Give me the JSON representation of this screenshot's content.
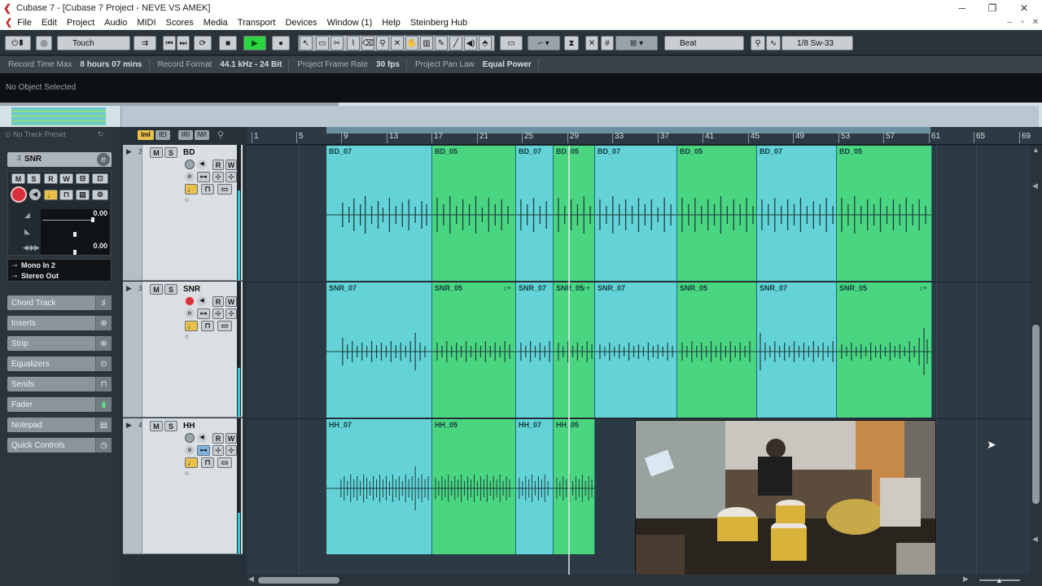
{
  "window": {
    "title": "Cubase 7 - [Cubase 7 Project - NEVE VS AMEK]",
    "controls": {
      "minimize": "─",
      "maximize": "❐",
      "close": "✕"
    }
  },
  "menu": {
    "items": [
      "File",
      "Edit",
      "Project",
      "Audio",
      "MIDI",
      "Scores",
      "Media",
      "Transport",
      "Devices",
      "Window (1)",
      "Help",
      "Steinberg Hub"
    ],
    "doc_controls": {
      "minimize": "–",
      "restore": "▫",
      "close": "✕"
    }
  },
  "toolbar": {
    "automation_mode": "Touch",
    "snap_type": "Beat",
    "quantize": "1/8 Sw-33",
    "play_color": "#2bd640"
  },
  "info_line": [
    {
      "label": "Record Time Max",
      "value": "8 hours 07 mins"
    },
    {
      "label": "Record Format",
      "value": "44.1 kHz - 24 Bit"
    },
    {
      "label": "Project Frame Rate",
      "value": "30 fps"
    },
    {
      "label": "Project Pan Law",
      "value": "Equal Power"
    }
  ],
  "object_line": "No Object Selected",
  "inspector": {
    "preset": "No Track Preset",
    "track_name": "SNR",
    "track_number": "3",
    "volume": "0.00",
    "pan": "0.00",
    "input": "Mono In 2",
    "output": "Stereo Out",
    "sections": [
      "Chord Track",
      "Inserts",
      "Strip",
      "Equalizers",
      "Sends",
      "Fader",
      "Notepad",
      "Quick Controls"
    ]
  },
  "tracks": [
    {
      "number": "2",
      "name": "BD",
      "parts": [
        {
          "name": "BD_07",
          "color": "cyan"
        },
        {
          "name": "BD_05",
          "color": "green"
        },
        {
          "name": "BD_07",
          "color": "cyan"
        },
        {
          "name": "BD_05",
          "color": "green"
        },
        {
          "name": "BD_07",
          "color": "cyan"
        },
        {
          "name": "BD_05",
          "color": "green"
        },
        {
          "name": "BD_07",
          "color": "cyan"
        },
        {
          "name": "BD_05",
          "color": "green"
        }
      ]
    },
    {
      "number": "3",
      "name": "SNR",
      "parts": [
        {
          "name": "SNR_07",
          "color": "cyan"
        },
        {
          "name": "SNR_05",
          "color": "green"
        },
        {
          "name": "SNR_07",
          "color": "cyan"
        },
        {
          "name": "SNR_05",
          "color": "green"
        },
        {
          "name": "SNR_07",
          "color": "cyan"
        },
        {
          "name": "SNR_05",
          "color": "green"
        },
        {
          "name": "SNR_07",
          "color": "cyan"
        },
        {
          "name": "SNR_05",
          "color": "green"
        }
      ]
    },
    {
      "number": "4",
      "name": "HH",
      "parts": [
        {
          "name": "HH_07",
          "color": "cyan"
        },
        {
          "name": "HH_05",
          "color": "green"
        },
        {
          "name": "HH_07",
          "color": "cyan"
        },
        {
          "name": "HH_05",
          "color": "green"
        }
      ]
    }
  ],
  "ruler": [
    "1",
    "5",
    "9",
    "13",
    "17",
    "21",
    "25",
    "29",
    "33",
    "37",
    "41",
    "45",
    "49",
    "53",
    "57",
    "61",
    "65",
    "69"
  ],
  "colors": {
    "part_cyan": "#63d3d8",
    "part_green": "#4ad680",
    "record": "#d9303a",
    "accent_yellow": "#e8c04a"
  }
}
